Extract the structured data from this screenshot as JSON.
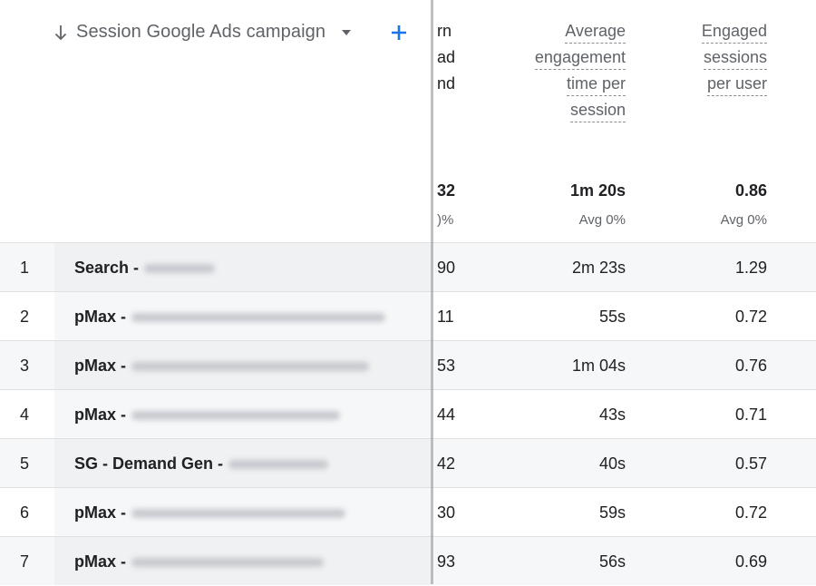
{
  "dimension": {
    "label": "Session Google Ads campaign",
    "sort_icon": "arrow-down-icon",
    "dropdown_icon": "caret-down-icon",
    "add_icon": "plus-icon"
  },
  "partial_column": {
    "header_fragments": [
      "rn",
      "ad",
      "nd"
    ],
    "total": "32",
    "total_sub": ")%",
    "values": [
      "90",
      "11",
      "53",
      "44",
      "42",
      "30",
      "93"
    ]
  },
  "columns": [
    {
      "header_lines": [
        "Average",
        "engagement",
        "time per",
        "session"
      ],
      "total": "1m 20s",
      "total_sub": "Avg 0%"
    },
    {
      "header_lines": [
        "Engaged",
        "sessions",
        "per user"
      ],
      "total": "0.86",
      "total_sub": "Avg 0%"
    }
  ],
  "rows": [
    {
      "index": "1",
      "name": "Search -",
      "c1": "2m 23s",
      "c2": "1.29"
    },
    {
      "index": "2",
      "name": "pMax -",
      "c1": "55s",
      "c2": "0.72"
    },
    {
      "index": "3",
      "name": "pMax -",
      "c1": "1m 04s",
      "c2": "0.76"
    },
    {
      "index": "4",
      "name": "pMax -",
      "c1": "43s",
      "c2": "0.71"
    },
    {
      "index": "5",
      "name": "SG - Demand Gen -",
      "c1": "40s",
      "c2": "0.57"
    },
    {
      "index": "6",
      "name": "pMax -",
      "c1": "59s",
      "c2": "0.72"
    },
    {
      "index": "7",
      "name": "pMax -",
      "c1": "56s",
      "c2": "0.69"
    }
  ],
  "colors": {
    "accent": "#1a73e8",
    "text": "#202124",
    "muted": "#5f6368"
  }
}
